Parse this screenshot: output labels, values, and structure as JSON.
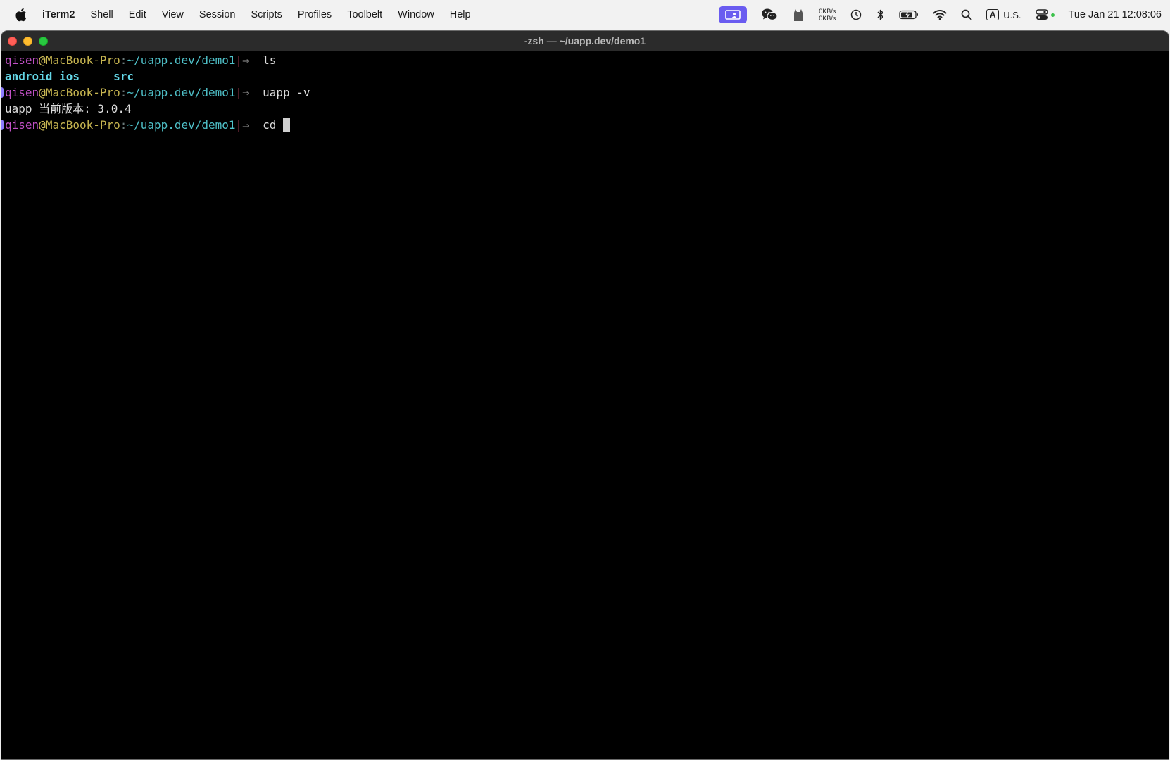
{
  "menubar": {
    "app_name": "iTerm2",
    "items": [
      "Shell",
      "Edit",
      "View",
      "Session",
      "Scripts",
      "Profiles",
      "Toolbelt",
      "Window",
      "Help"
    ],
    "netspeed_up": "0KB/s",
    "netspeed_down": "0KB/s",
    "input_source_letter": "A",
    "input_source": "U.S.",
    "clock": "Tue Jan 21  12:08:06",
    "icons": [
      "apple-icon",
      "screen-share-icon",
      "wechat-icon",
      "cat-icon",
      "time-machine-icon",
      "bluetooth-icon",
      "battery-icon",
      "wifi-icon",
      "spotlight-icon",
      "control-center-icon"
    ],
    "colors": {
      "screen_share_bg": "#6a5cf0"
    }
  },
  "window": {
    "title": "-zsh — ~/uapp.dev/demo1"
  },
  "prompt": {
    "user": "qisen",
    "at": "@",
    "host": "MacBook-Pro",
    "colon": ":",
    "path": "~/uapp.dev/demo1",
    "bar": "|",
    "arrow": "⇒"
  },
  "terminal": {
    "lines": [
      {
        "type": "prompt",
        "command": "ls"
      },
      {
        "type": "dirs",
        "entries": [
          "android",
          "ios",
          "src"
        ]
      },
      {
        "type": "prompt",
        "command": "uapp -v"
      },
      {
        "type": "output",
        "text": "uapp 当前版本: 3.0.4"
      },
      {
        "type": "prompt",
        "command": "cd "
      }
    ]
  }
}
